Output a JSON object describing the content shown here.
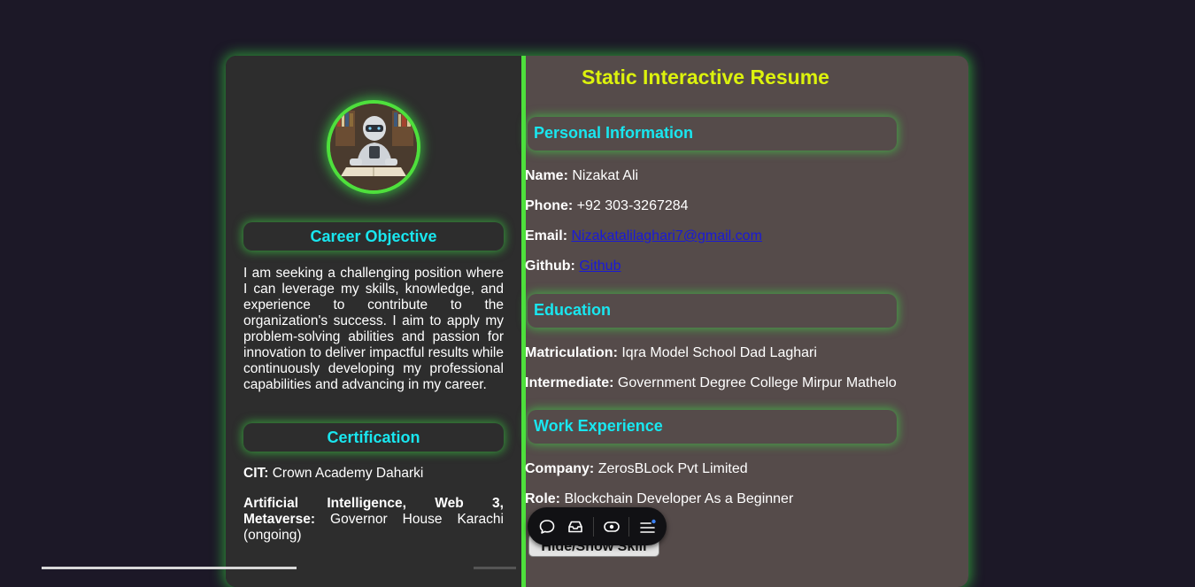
{
  "title": "Static Interactive Resume",
  "sidebar": {
    "career_heading": "Career Objective",
    "career_text": "I am seeking a challenging position where I can leverage my skills, knowledge, and experience to contribute to the organization's success. I aim to apply my problem-solving abilities and passion for innovation to deliver impactful results while continuously developing my professional capabilities and advancing in my career.",
    "cert_heading": "Certification",
    "cert1_label": "CIT:",
    "cert1_value": "Crown Academy Daharki",
    "cert2_label": "Artificial Intelligence, Web 3, Metaverse:",
    "cert2_value": "Governor House Karachi (ongoing)"
  },
  "personal": {
    "heading": "Personal Information",
    "name_label": "Name:",
    "name": "Nizakat Ali",
    "phone_label": "Phone:",
    "phone": "+92 303-3267284",
    "email_label": "Email:",
    "email": "Nizakatalilaghari7@gmail.com",
    "github_label": "Github:",
    "github": "Github"
  },
  "education": {
    "heading": "Education",
    "matric_label": "Matriculation:",
    "matric": "Iqra Model School Dad Laghari",
    "inter_label": "Intermediate:",
    "inter": "Government Degree College Mirpur Mathelo"
  },
  "work": {
    "heading": "Work Experience",
    "company_label": "Company:",
    "company": "ZerosBLock Pvt Limited",
    "role_label": "Role:",
    "role": "Blockchain Developer As a Beginner"
  },
  "skills_button": "Hide/Show Skill",
  "toolbar": {
    "icons": [
      "chat-icon",
      "inbox-icon",
      "eye-icon",
      "menu-icon"
    ]
  },
  "colors": {
    "accent_green": "#4ee03c",
    "heading_cyan": "#19e6ef",
    "title_yellow": "#dcf20d",
    "left_bg": "#2d2d2d",
    "right_bg": "#554b4a",
    "page_bg": "#1c1827"
  }
}
